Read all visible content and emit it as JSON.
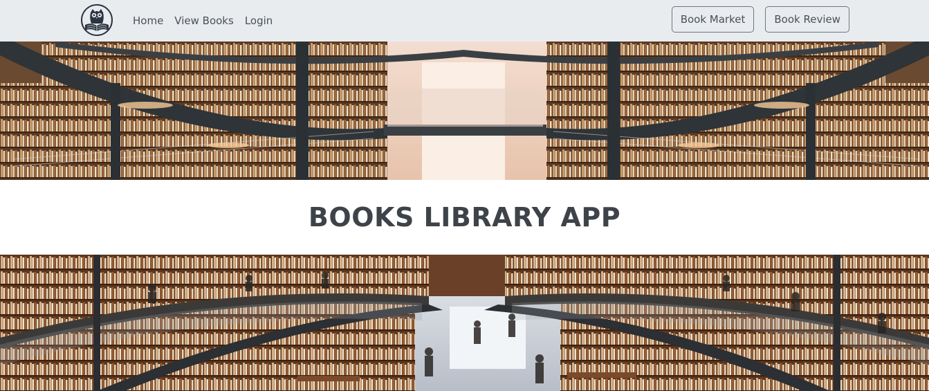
{
  "navbar": {
    "logo_icon": "owl-book-icon",
    "links": [
      {
        "label": "Home"
      },
      {
        "label": "View Books"
      },
      {
        "label": "Login"
      }
    ],
    "actions": [
      {
        "label": "Book Market"
      },
      {
        "label": "Book Review"
      }
    ]
  },
  "main": {
    "title": "BOOKS LIBRARY APP"
  },
  "colors": {
    "navbar_bg": "#e9ecef",
    "title_text": "#3d4349",
    "button_border": "#6c757d"
  }
}
